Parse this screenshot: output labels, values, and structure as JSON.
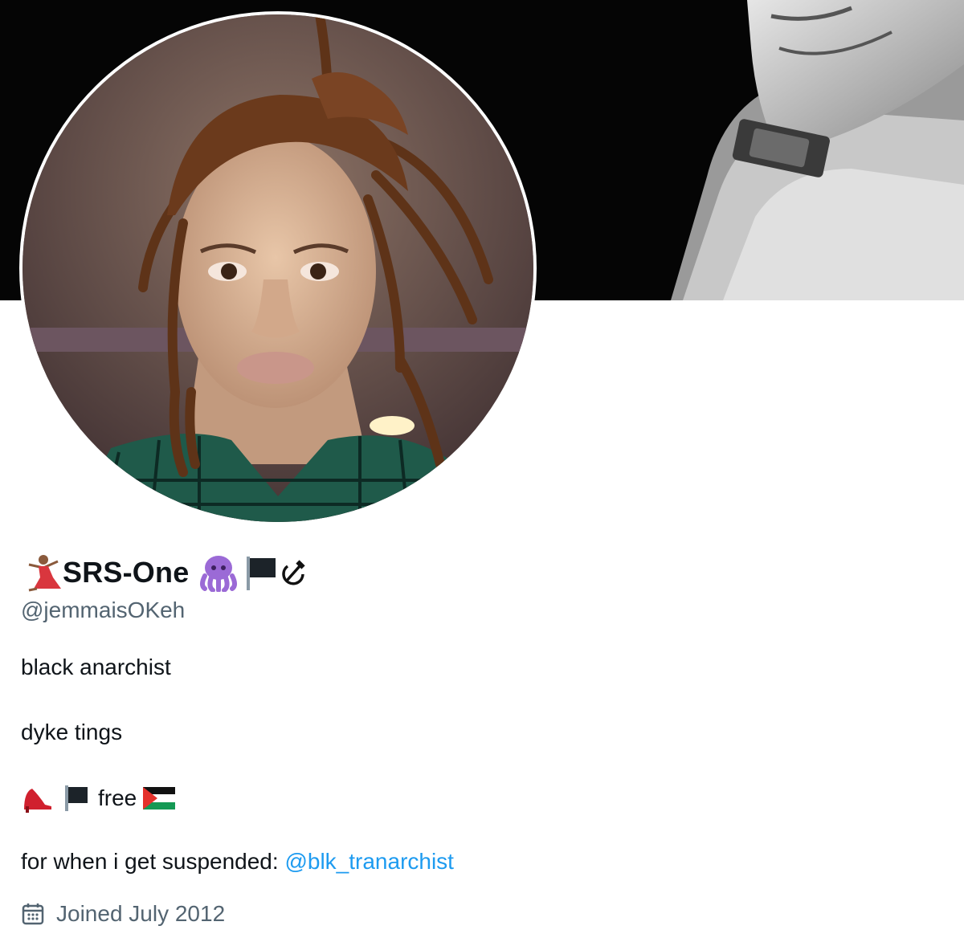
{
  "profile": {
    "display_name": "SRS-One",
    "name_emojis": [
      "dancer-icon",
      "octopus-icon",
      "black-flag-icon",
      "hammer-sickle-icon"
    ],
    "handle": "@jemmaisOKeh",
    "bio": {
      "line1": "black anarchist",
      "line2": "dyke tings",
      "line3_text": "free",
      "line3_emojis": [
        "high-heel-icon",
        "black-flag-icon",
        "palestine-flag-icon"
      ],
      "line4_prefix": "for when i get suspended: ",
      "line4_link": "@blk_tranarchist"
    },
    "joined": "Joined July 2012",
    "joined_icon": "calendar-icon"
  },
  "colors": {
    "link": "#1d9bf0",
    "secondary_text": "#536471",
    "primary_text": "#0f1419"
  }
}
